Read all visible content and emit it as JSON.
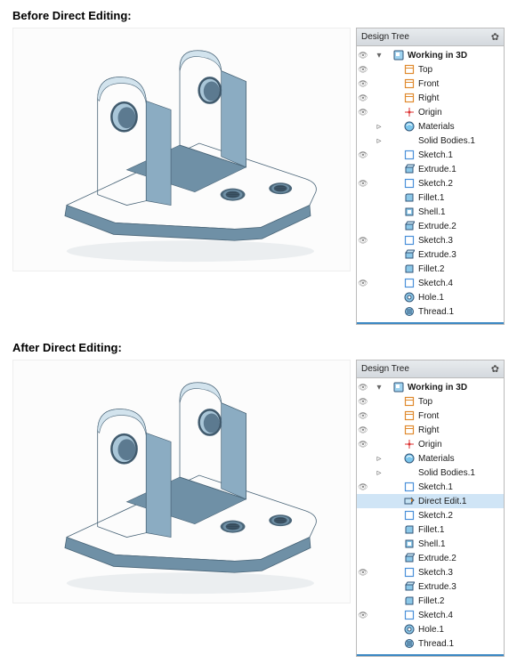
{
  "titles": {
    "before": "Before Direct Editing:",
    "after": "After Direct Editing:"
  },
  "panels": {
    "before": {
      "title": "Design Tree",
      "items": [
        {
          "eye": true,
          "expand": "▾",
          "depth": 0,
          "icon": "part",
          "label": "Working in 3D",
          "bold": true
        },
        {
          "eye": true,
          "expand": "",
          "depth": 1,
          "icon": "plane",
          "label": "Top"
        },
        {
          "eye": true,
          "expand": "",
          "depth": 1,
          "icon": "plane",
          "label": "Front"
        },
        {
          "eye": true,
          "expand": "",
          "depth": 1,
          "icon": "plane",
          "label": "Right"
        },
        {
          "eye": true,
          "expand": "",
          "depth": 1,
          "icon": "origin",
          "label": "Origin"
        },
        {
          "eye": false,
          "expand": "▹",
          "depth": 1,
          "icon": "materials",
          "label": "Materials"
        },
        {
          "eye": false,
          "expand": "▹",
          "depth": 1,
          "icon": "",
          "label": "Solid Bodies.1"
        },
        {
          "eye": true,
          "expand": "",
          "depth": 1,
          "icon": "sketch",
          "label": "Sketch.1"
        },
        {
          "eye": false,
          "expand": "",
          "depth": 1,
          "icon": "extrude",
          "label": "Extrude.1"
        },
        {
          "eye": true,
          "expand": "",
          "depth": 1,
          "icon": "sketch",
          "label": "Sketch.2"
        },
        {
          "eye": false,
          "expand": "",
          "depth": 1,
          "icon": "fillet",
          "label": "Fillet.1"
        },
        {
          "eye": false,
          "expand": "",
          "depth": 1,
          "icon": "shell",
          "label": "Shell.1"
        },
        {
          "eye": false,
          "expand": "",
          "depth": 1,
          "icon": "extrude",
          "label": "Extrude.2"
        },
        {
          "eye": true,
          "expand": "",
          "depth": 1,
          "icon": "sketch",
          "label": "Sketch.3"
        },
        {
          "eye": false,
          "expand": "",
          "depth": 1,
          "icon": "extrude",
          "label": "Extrude.3"
        },
        {
          "eye": false,
          "expand": "",
          "depth": 1,
          "icon": "fillet",
          "label": "Fillet.2"
        },
        {
          "eye": true,
          "expand": "",
          "depth": 1,
          "icon": "sketch",
          "label": "Sketch.4"
        },
        {
          "eye": false,
          "expand": "",
          "depth": 1,
          "icon": "hole",
          "label": "Hole.1"
        },
        {
          "eye": false,
          "expand": "",
          "depth": 1,
          "icon": "thread",
          "label": "Thread.1"
        }
      ]
    },
    "after": {
      "title": "Design Tree",
      "items": [
        {
          "eye": true,
          "expand": "▾",
          "depth": 0,
          "icon": "part",
          "label": "Working in 3D",
          "bold": true
        },
        {
          "eye": true,
          "expand": "",
          "depth": 1,
          "icon": "plane",
          "label": "Top"
        },
        {
          "eye": true,
          "expand": "",
          "depth": 1,
          "icon": "plane",
          "label": "Front"
        },
        {
          "eye": true,
          "expand": "",
          "depth": 1,
          "icon": "plane",
          "label": "Right"
        },
        {
          "eye": true,
          "expand": "",
          "depth": 1,
          "icon": "origin",
          "label": "Origin"
        },
        {
          "eye": false,
          "expand": "▹",
          "depth": 1,
          "icon": "materials",
          "label": "Materials"
        },
        {
          "eye": false,
          "expand": "▹",
          "depth": 1,
          "icon": "",
          "label": "Solid Bodies.1"
        },
        {
          "eye": true,
          "expand": "",
          "depth": 1,
          "icon": "sketch",
          "label": "Sketch.1"
        },
        {
          "eye": false,
          "expand": "",
          "depth": 1,
          "icon": "direct",
          "label": "Direct Edit.1",
          "highlight": true
        },
        {
          "eye": false,
          "expand": "",
          "depth": 1,
          "icon": "sketch",
          "label": "Sketch.2"
        },
        {
          "eye": false,
          "expand": "",
          "depth": 1,
          "icon": "fillet",
          "label": "Fillet.1"
        },
        {
          "eye": false,
          "expand": "",
          "depth": 1,
          "icon": "shell",
          "label": "Shell.1"
        },
        {
          "eye": false,
          "expand": "",
          "depth": 1,
          "icon": "extrude",
          "label": "Extrude.2"
        },
        {
          "eye": true,
          "expand": "",
          "depth": 1,
          "icon": "sketch",
          "label": "Sketch.3"
        },
        {
          "eye": false,
          "expand": "",
          "depth": 1,
          "icon": "extrude",
          "label": "Extrude.3"
        },
        {
          "eye": false,
          "expand": "",
          "depth": 1,
          "icon": "fillet",
          "label": "Fillet.2"
        },
        {
          "eye": true,
          "expand": "",
          "depth": 1,
          "icon": "sketch",
          "label": "Sketch.4"
        },
        {
          "eye": false,
          "expand": "",
          "depth": 1,
          "icon": "hole",
          "label": "Hole.1"
        },
        {
          "eye": false,
          "expand": "",
          "depth": 1,
          "icon": "thread",
          "label": "Thread.1"
        }
      ]
    }
  }
}
